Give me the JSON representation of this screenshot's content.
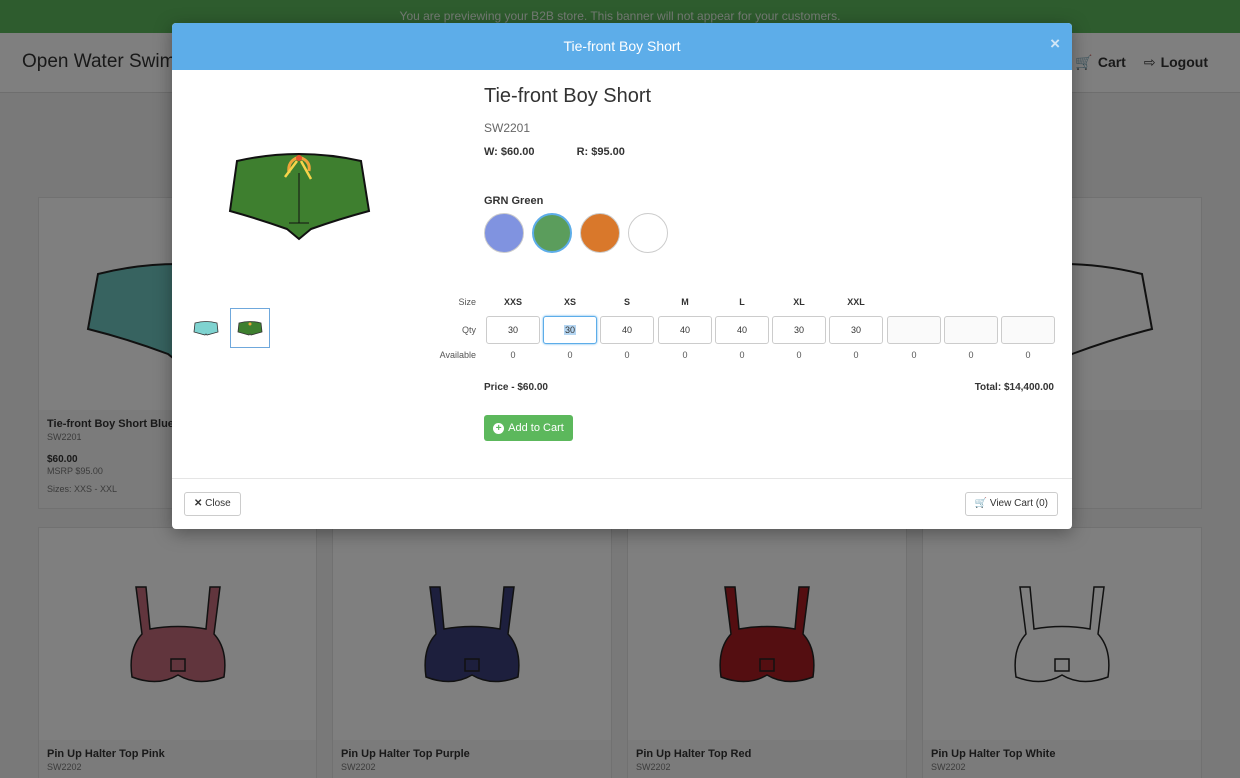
{
  "banner": "You are previewing your B2B store. This banner will not appear for your customers.",
  "navbar": {
    "brand": "Open Water Swim",
    "cart_label": "Cart",
    "logout_label": "Logout"
  },
  "background_products": [
    {
      "name": "Tie-front Boy Short Blue",
      "sku": "SW2201",
      "price": "$60.00",
      "msrp": "MSRP $95.00",
      "sizes": "Sizes: XXS - XXL",
      "color": "#6fc7c0"
    },
    {
      "name": "Pin Up Halter Top Pink",
      "sku": "SW2202",
      "color": "#c36a7b"
    },
    {
      "name": "Pin Up Halter Top Purple",
      "sku": "SW2202",
      "color": "#3a3f7a"
    },
    {
      "name": "Pin Up Halter Top Red",
      "sku": "SW2202",
      "color": "#a81c22"
    },
    {
      "name": "Pin Up Halter Top White",
      "sku": "SW2202",
      "color": "#ffffff"
    }
  ],
  "modal": {
    "header_title": "Tie-front Boy Short",
    "close_x": "×",
    "product_title": "Tie-front Boy Short",
    "sku": "SW2201",
    "wholesale": "W: $60.00",
    "retail": "R: $95.00",
    "selected_color": "GRN Green",
    "swatches": [
      "#8093e0",
      "#5b9d5c",
      "#d9782b",
      "#ffffff"
    ],
    "size_label": "Size",
    "qty_label": "Qty",
    "available_label": "Available",
    "sizes": [
      "XXS",
      "XS",
      "S",
      "M",
      "L",
      "XL",
      "XXL",
      "",
      "",
      ""
    ],
    "quantities": [
      "30",
      "30",
      "40",
      "40",
      "40",
      "30",
      "30",
      "",
      "",
      ""
    ],
    "available": [
      "0",
      "0",
      "0",
      "0",
      "0",
      "0",
      "0",
      "0",
      "0",
      "0"
    ],
    "price_line": "Price - $60.00",
    "total_line": "Total: $14,400.00",
    "add_to_cart": "Add to Cart",
    "close_button": "Close",
    "view_cart_button": "View Cart (0)"
  },
  "colors": {
    "header_blue": "#5dade9",
    "success_green": "#5cb85c",
    "product_green": "#3e7f2f"
  }
}
